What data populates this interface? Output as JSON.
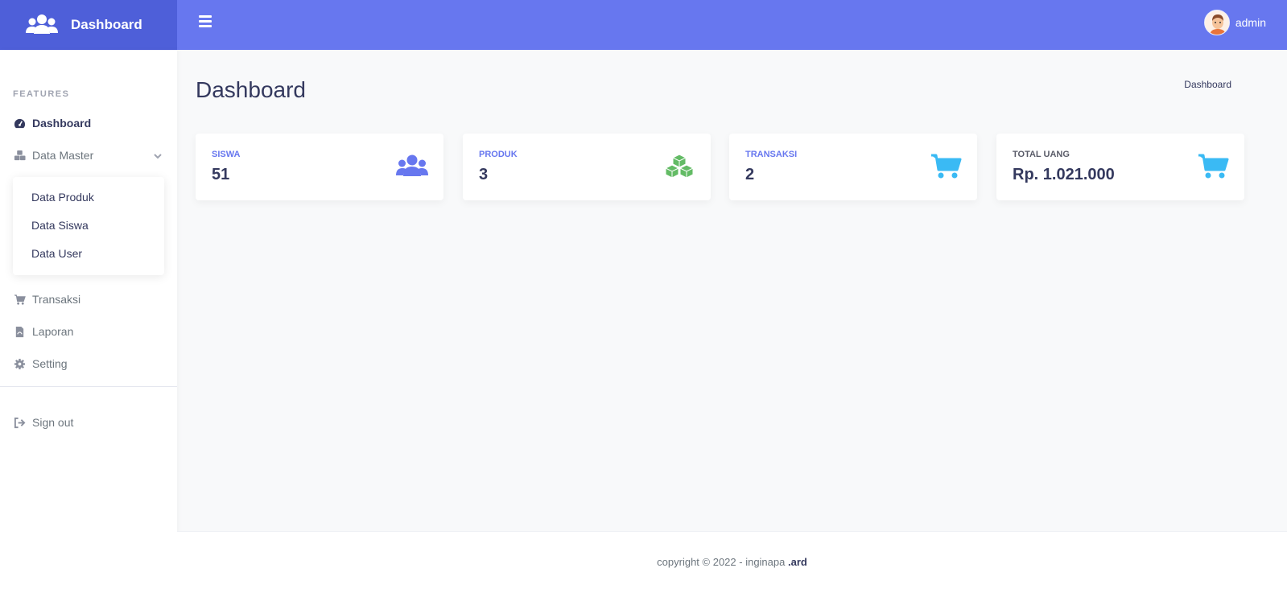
{
  "brand": {
    "title": "Dashboard",
    "icon": "users-icon"
  },
  "topbar": {
    "user_name": "admin",
    "accent": "#6777ef"
  },
  "sidebar": {
    "header": "FEATURES",
    "items": [
      {
        "label": "Dashboard",
        "icon": "dashboard-gauge-icon"
      },
      {
        "label": "Data Master",
        "icon": "cubes-icon"
      },
      {
        "label": "Transaksi",
        "icon": "cart-icon"
      },
      {
        "label": "Laporan",
        "icon": "pdf-file-icon"
      },
      {
        "label": "Setting",
        "icon": "gear-icon"
      },
      {
        "label": "Sign out",
        "icon": "sign-out-icon"
      }
    ],
    "submenu": [
      "Data Produk",
      "Data Siswa",
      "Data User"
    ]
  },
  "page": {
    "title": "Dashboard",
    "breadcrumb": "Dashboard"
  },
  "cards": [
    {
      "label": "SISWA",
      "value": "51",
      "color": "#6777ef",
      "icon": "users-icon"
    },
    {
      "label": "PRODUK",
      "value": "3",
      "color": "#63bb65",
      "icon": "cubes-icon"
    },
    {
      "label": "TRANSAKSI",
      "value": "2",
      "color": "#3abaf4",
      "icon": "cart-icon"
    },
    {
      "label": "TOTAL UANG",
      "value": "Rp. 1.021.000",
      "color": "#3abaf4",
      "icon": "cart-icon"
    }
  ],
  "footer": {
    "text": "copyright © 2022 - inginapa",
    "brand": ".ard"
  }
}
